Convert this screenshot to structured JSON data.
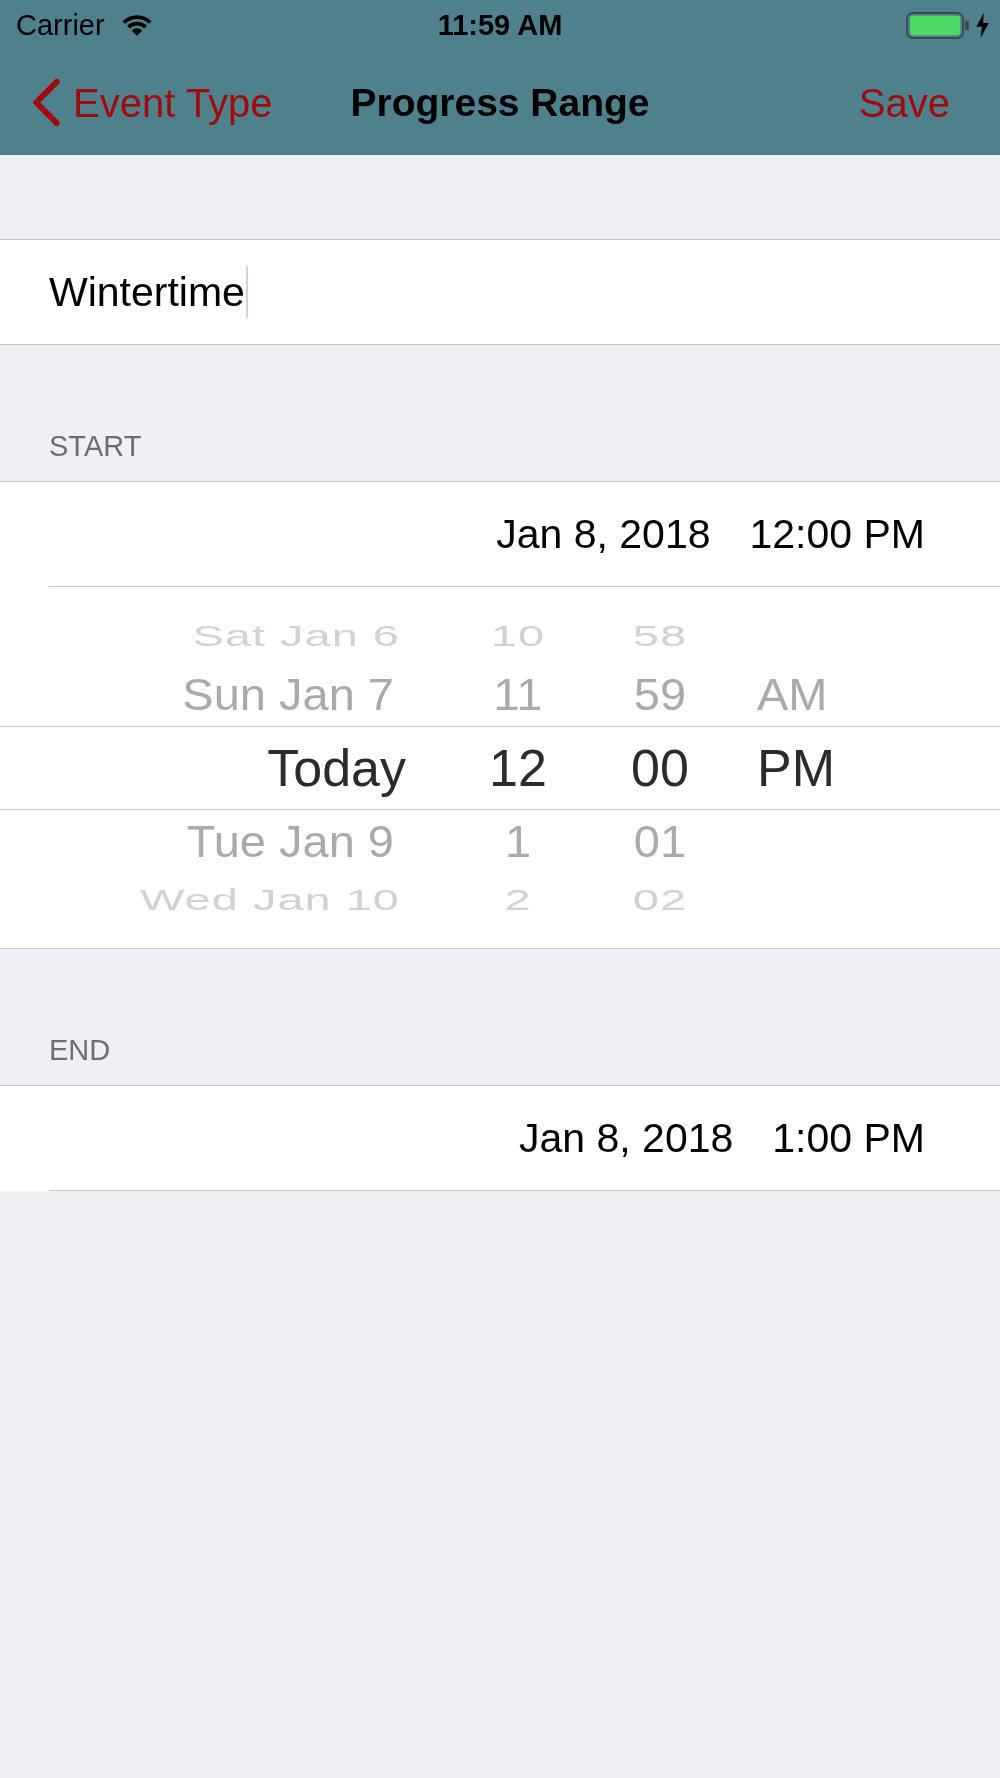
{
  "status_bar": {
    "carrier": "Carrier",
    "time": "11:59 AM"
  },
  "nav_bar": {
    "back": "Event Type",
    "title": "Progress Range",
    "action": "Save"
  },
  "name_field": {
    "value": "Wintertime",
    "focused": true
  },
  "sections": [
    {
      "header": "START",
      "date": "Jan 8, 2018",
      "time": "12:00 PM",
      "picker": {
        "columns": [
          {
            "kind": "date",
            "items": [
              {
                "label": "Sat Jan 6",
                "selected": false
              },
              {
                "label": "Sun Jan 7",
                "selected": false
              },
              {
                "label": "Today",
                "selected": true
              },
              {
                "label": "Tue Jan 9",
                "selected": false
              },
              {
                "label": "Wed Jan 10",
                "selected": false
              }
            ]
          },
          {
            "kind": "hour",
            "items": [
              {
                "label": "10",
                "selected": false
              },
              {
                "label": "11",
                "selected": false
              },
              {
                "label": "12",
                "selected": true
              },
              {
                "label": "1",
                "selected": false
              },
              {
                "label": "2",
                "selected": false
              }
            ]
          },
          {
            "kind": "minute",
            "items": [
              {
                "label": "58",
                "selected": false
              },
              {
                "label": "59",
                "selected": false
              },
              {
                "label": "00",
                "selected": true
              },
              {
                "label": "01",
                "selected": false
              },
              {
                "label": "02",
                "selected": false
              }
            ]
          },
          {
            "kind": "meridiem",
            "items": [
              {
                "label": "AM",
                "selected": false
              },
              {
                "label": "PM",
                "selected": true
              }
            ]
          }
        ]
      }
    },
    {
      "header": "END",
      "date": "Jan 8, 2018",
      "time": "1:00 PM"
    }
  ]
}
